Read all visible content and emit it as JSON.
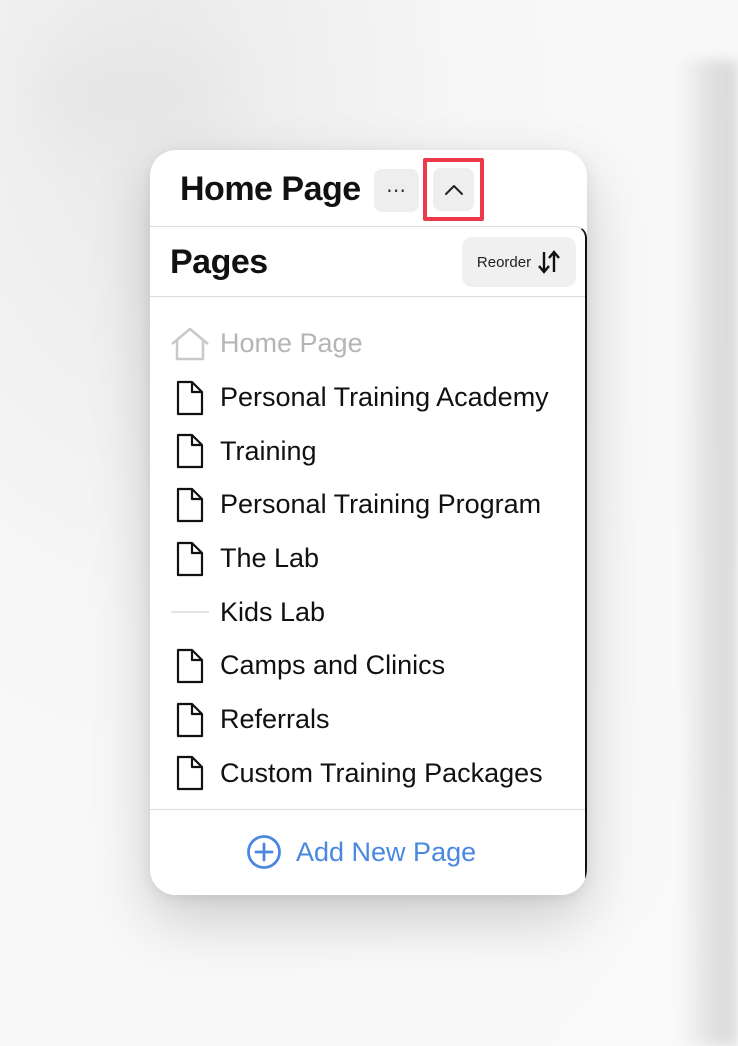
{
  "header": {
    "title": "Home Page",
    "more_label": "⋯"
  },
  "panel": {
    "title": "Pages",
    "reorder_label": "Reorder"
  },
  "pages": [
    {
      "label": "Home Page",
      "icon": "home-icon",
      "muted": true
    },
    {
      "label": "Personal Training Academy",
      "icon": "document-icon"
    },
    {
      "label": "Training",
      "icon": "document-icon"
    },
    {
      "label": "Personal Training Program",
      "icon": "document-icon"
    },
    {
      "label": "The Lab",
      "icon": "document-icon"
    },
    {
      "label": "Kids Lab",
      "icon": "divider-line-icon"
    },
    {
      "label": "Camps and Clinics",
      "icon": "document-icon"
    },
    {
      "label": "Referrals",
      "icon": "document-icon"
    },
    {
      "label": "Custom Training Packages",
      "icon": "document-icon"
    }
  ],
  "footer": {
    "add_label": "Add New Page"
  },
  "colors": {
    "accent": "#4a88e0",
    "highlight": "#ec3a4b",
    "muted_text": "#b5b5b5"
  }
}
